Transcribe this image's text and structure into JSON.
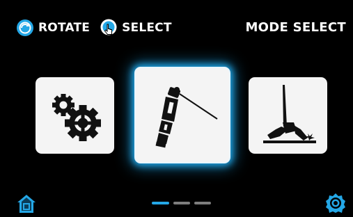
{
  "header": {
    "rotate_label": "ROTATE",
    "select_label": "SELECT",
    "mode_title": "MODE SELECT"
  },
  "cards": [
    {
      "icon": "gears-icon",
      "label": "",
      "selected": false
    },
    {
      "icon": "tig-torch-icon",
      "label": "",
      "selected": true
    },
    {
      "icon": "stick-welding-icon",
      "label": "",
      "selected": false
    }
  ],
  "pager": {
    "total": 3,
    "active_index": 0
  },
  "footer": {
    "home_icon": "home-icon",
    "settings_icon": "gear-icon"
  },
  "colors": {
    "accent": "#24a7e6",
    "background": "#000000",
    "card": "#f4f4f4",
    "inactive_dot": "#7d7d7d"
  }
}
